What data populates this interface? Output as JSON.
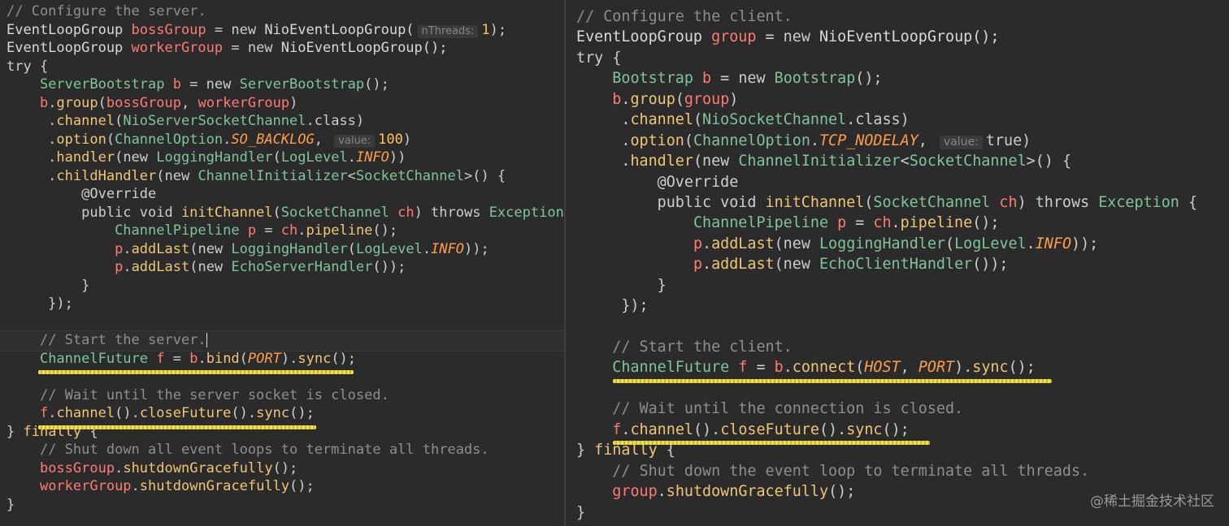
{
  "left_editor": {
    "lines": [
      [
        [
          "comment",
          "// Configure the server."
        ]
      ],
      [
        [
          "type",
          "EventLoopGroup "
        ],
        [
          "var",
          "bossGroup"
        ],
        [
          "default",
          " = new "
        ],
        [
          "type",
          "NioEventLoopGroup("
        ],
        [
          "hint",
          "nThreads:"
        ],
        [
          "number",
          "1"
        ],
        [
          "default",
          ");"
        ]
      ],
      [
        [
          "type",
          "EventLoopGroup "
        ],
        [
          "var",
          "workerGroup"
        ],
        [
          "default",
          " = new "
        ],
        [
          "type",
          "NioEventLoopGroup();"
        ]
      ],
      [
        [
          "default",
          "try {"
        ]
      ],
      [
        [
          "default",
          "    "
        ],
        [
          "cls",
          "ServerBootstrap "
        ],
        [
          "var",
          "b"
        ],
        [
          "default",
          " = new "
        ],
        [
          "cls",
          "ServerBootstrap"
        ],
        [
          "default",
          "();"
        ]
      ],
      [
        [
          "default",
          "    "
        ],
        [
          "var",
          "b"
        ],
        [
          "default",
          "."
        ],
        [
          "method",
          "group"
        ],
        [
          "default",
          "("
        ],
        [
          "var",
          "bossGroup"
        ],
        [
          "default",
          ", "
        ],
        [
          "var",
          "workerGroup"
        ],
        [
          "default",
          ")"
        ]
      ],
      [
        [
          "default",
          "     ."
        ],
        [
          "method",
          "channel"
        ],
        [
          "default",
          "("
        ],
        [
          "cls",
          "NioServerSocketChannel"
        ],
        [
          "default",
          ".class)"
        ]
      ],
      [
        [
          "default",
          "     ."
        ],
        [
          "method",
          "option"
        ],
        [
          "default",
          "("
        ],
        [
          "cls",
          "ChannelOption"
        ],
        [
          "default",
          "."
        ],
        [
          "constant",
          "SO_BACKLOG"
        ],
        [
          "default",
          ", "
        ],
        [
          "hint",
          "value:"
        ],
        [
          "number",
          "100"
        ],
        [
          "default",
          ")"
        ]
      ],
      [
        [
          "default",
          "     ."
        ],
        [
          "method",
          "handler"
        ],
        [
          "default",
          "(new "
        ],
        [
          "cls",
          "LoggingHandler"
        ],
        [
          "default",
          "("
        ],
        [
          "cls",
          "LogLevel"
        ],
        [
          "default",
          "."
        ],
        [
          "constant",
          "INFO"
        ],
        [
          "default",
          "))"
        ]
      ],
      [
        [
          "default",
          "     ."
        ],
        [
          "method",
          "childHandler"
        ],
        [
          "default",
          "(new "
        ],
        [
          "cls",
          "ChannelInitializer"
        ],
        [
          "default",
          "<"
        ],
        [
          "cls",
          "SocketChannel"
        ],
        [
          "default",
          ">() {"
        ]
      ],
      [
        [
          "default",
          "         "
        ],
        [
          "annotation",
          "@Override"
        ]
      ],
      [
        [
          "default",
          "         public void "
        ],
        [
          "method",
          "initChannel"
        ],
        [
          "default",
          "("
        ],
        [
          "cls",
          "SocketChannel "
        ],
        [
          "var",
          "ch"
        ],
        [
          "default",
          ") throws "
        ],
        [
          "cls",
          "Exception"
        ]
      ],
      [
        [
          "default",
          "             "
        ],
        [
          "cls",
          "ChannelPipeline "
        ],
        [
          "var",
          "p"
        ],
        [
          "default",
          " = "
        ],
        [
          "var",
          "ch"
        ],
        [
          "default",
          "."
        ],
        [
          "method",
          "pipeline"
        ],
        [
          "default",
          "();"
        ]
      ],
      [
        [
          "default",
          "             "
        ],
        [
          "var",
          "p"
        ],
        [
          "default",
          "."
        ],
        [
          "method",
          "addLast"
        ],
        [
          "default",
          "(new "
        ],
        [
          "cls",
          "LoggingHandler"
        ],
        [
          "default",
          "("
        ],
        [
          "cls",
          "LogLevel"
        ],
        [
          "default",
          "."
        ],
        [
          "constant",
          "INFO"
        ],
        [
          "default",
          "));"
        ]
      ],
      [
        [
          "default",
          "             "
        ],
        [
          "var",
          "p"
        ],
        [
          "default",
          "."
        ],
        [
          "method",
          "addLast"
        ],
        [
          "default",
          "(new "
        ],
        [
          "cls",
          "EchoServerHandler"
        ],
        [
          "default",
          "());"
        ]
      ],
      [
        [
          "default",
          "         }"
        ]
      ],
      [
        [
          "default",
          "     });"
        ]
      ],
      [
        [
          "default",
          ""
        ]
      ],
      [
        [
          "default",
          "    "
        ],
        [
          "comment",
          "// Start the server."
        ]
      ],
      [
        [
          "default",
          "    "
        ],
        [
          "cls",
          "ChannelFuture "
        ],
        [
          "var",
          "f"
        ],
        [
          "default",
          " = "
        ],
        [
          "var",
          "b"
        ],
        [
          "default",
          "."
        ],
        [
          "method",
          "bind"
        ],
        [
          "default",
          "("
        ],
        [
          "constant",
          "PORT"
        ],
        [
          "default",
          ")."
        ],
        [
          "method",
          "sync"
        ],
        [
          "default",
          "();"
        ]
      ],
      [
        [
          "default",
          ""
        ]
      ],
      [
        [
          "default",
          "    "
        ],
        [
          "comment",
          "// Wait until the server socket is closed."
        ]
      ],
      [
        [
          "default",
          "    "
        ],
        [
          "var",
          "f"
        ],
        [
          "default",
          "."
        ],
        [
          "method",
          "channel"
        ],
        [
          "default",
          "()."
        ],
        [
          "method",
          "closeFuture"
        ],
        [
          "default",
          "()."
        ],
        [
          "method",
          "sync"
        ],
        [
          "default",
          "();"
        ]
      ],
      [
        [
          "default",
          "} "
        ],
        [
          "method",
          "finally"
        ],
        [
          "default",
          " {"
        ]
      ],
      [
        [
          "default",
          "    "
        ],
        [
          "comment",
          "// Shut down all event loops to terminate all threads."
        ]
      ],
      [
        [
          "default",
          "    "
        ],
        [
          "var",
          "bossGroup"
        ],
        [
          "default",
          "."
        ],
        [
          "method",
          "shutdownGracefully"
        ],
        [
          "default",
          "();"
        ]
      ],
      [
        [
          "default",
          "    "
        ],
        [
          "var",
          "workerGroup"
        ],
        [
          "default",
          "."
        ],
        [
          "method",
          "shutdownGracefully"
        ],
        [
          "default",
          "();"
        ]
      ],
      [
        [
          "default",
          "}"
        ]
      ]
    ]
  },
  "right_editor": {
    "lines": [
      [
        [
          "comment",
          "// Configure the client."
        ]
      ],
      [
        [
          "type",
          "EventLoopGroup "
        ],
        [
          "var",
          "group"
        ],
        [
          "default",
          " = new "
        ],
        [
          "type",
          "NioEventLoopGroup();"
        ]
      ],
      [
        [
          "default",
          "try {"
        ]
      ],
      [
        [
          "default",
          "    "
        ],
        [
          "cls",
          "Bootstrap "
        ],
        [
          "var",
          "b"
        ],
        [
          "default",
          " = new "
        ],
        [
          "cls",
          "Bootstrap"
        ],
        [
          "default",
          "();"
        ]
      ],
      [
        [
          "default",
          "    "
        ],
        [
          "var",
          "b"
        ],
        [
          "default",
          "."
        ],
        [
          "method",
          "group"
        ],
        [
          "default",
          "("
        ],
        [
          "var",
          "group"
        ],
        [
          "default",
          ")"
        ]
      ],
      [
        [
          "default",
          "     ."
        ],
        [
          "method",
          "channel"
        ],
        [
          "default",
          "("
        ],
        [
          "cls",
          "NioSocketChannel"
        ],
        [
          "default",
          ".class)"
        ]
      ],
      [
        [
          "default",
          "     ."
        ],
        [
          "method",
          "option"
        ],
        [
          "default",
          "("
        ],
        [
          "cls",
          "ChannelOption"
        ],
        [
          "default",
          "."
        ],
        [
          "constant",
          "TCP_NODELAY"
        ],
        [
          "default",
          ", "
        ],
        [
          "hint",
          "value:"
        ],
        [
          "default",
          "true)"
        ]
      ],
      [
        [
          "default",
          "     ."
        ],
        [
          "method",
          "handler"
        ],
        [
          "default",
          "(new "
        ],
        [
          "cls",
          "ChannelInitializer"
        ],
        [
          "default",
          "<"
        ],
        [
          "cls",
          "SocketChannel"
        ],
        [
          "default",
          ">() {"
        ]
      ],
      [
        [
          "default",
          "         "
        ],
        [
          "annotation",
          "@Override"
        ]
      ],
      [
        [
          "default",
          "         public void "
        ],
        [
          "method",
          "initChannel"
        ],
        [
          "default",
          "("
        ],
        [
          "cls",
          "SocketChannel "
        ],
        [
          "var",
          "ch"
        ],
        [
          "default",
          ") throws "
        ],
        [
          "cls",
          "Exception"
        ],
        [
          "default",
          " {"
        ]
      ],
      [
        [
          "default",
          "             "
        ],
        [
          "cls",
          "ChannelPipeline "
        ],
        [
          "var",
          "p"
        ],
        [
          "default",
          " = "
        ],
        [
          "var",
          "ch"
        ],
        [
          "default",
          "."
        ],
        [
          "method",
          "pipeline"
        ],
        [
          "default",
          "();"
        ]
      ],
      [
        [
          "default",
          "             "
        ],
        [
          "var",
          "p"
        ],
        [
          "default",
          "."
        ],
        [
          "method",
          "addLast"
        ],
        [
          "default",
          "(new "
        ],
        [
          "cls",
          "LoggingHandler"
        ],
        [
          "default",
          "("
        ],
        [
          "cls",
          "LogLevel"
        ],
        [
          "default",
          "."
        ],
        [
          "constant",
          "INFO"
        ],
        [
          "default",
          "));"
        ]
      ],
      [
        [
          "default",
          "             "
        ],
        [
          "var",
          "p"
        ],
        [
          "default",
          "."
        ],
        [
          "method",
          "addLast"
        ],
        [
          "default",
          "(new "
        ],
        [
          "cls",
          "EchoClientHandler"
        ],
        [
          "default",
          "());"
        ]
      ],
      [
        [
          "default",
          "         }"
        ]
      ],
      [
        [
          "default",
          "     });"
        ]
      ],
      [
        [
          "default",
          ""
        ]
      ],
      [
        [
          "default",
          "    "
        ],
        [
          "comment",
          "// Start the client."
        ]
      ],
      [
        [
          "default",
          "    "
        ],
        [
          "cls",
          "ChannelFuture "
        ],
        [
          "var",
          "f"
        ],
        [
          "default",
          " = "
        ],
        [
          "var",
          "b"
        ],
        [
          "default",
          "."
        ],
        [
          "method",
          "connect"
        ],
        [
          "default",
          "("
        ],
        [
          "constant",
          "HOST"
        ],
        [
          "default",
          ", "
        ],
        [
          "constant",
          "PORT"
        ],
        [
          "default",
          ")."
        ],
        [
          "method",
          "sync"
        ],
        [
          "default",
          "();"
        ]
      ],
      [
        [
          "default",
          ""
        ]
      ],
      [
        [
          "default",
          "    "
        ],
        [
          "comment",
          "// Wait until the connection is closed."
        ]
      ],
      [
        [
          "default",
          "    "
        ],
        [
          "var",
          "f"
        ],
        [
          "default",
          "."
        ],
        [
          "method",
          "channel"
        ],
        [
          "default",
          "()."
        ],
        [
          "method",
          "closeFuture"
        ],
        [
          "default",
          "()."
        ],
        [
          "method",
          "sync"
        ],
        [
          "default",
          "();"
        ]
      ],
      [
        [
          "default",
          "} "
        ],
        [
          "method",
          "finally"
        ],
        [
          "default",
          " {"
        ]
      ],
      [
        [
          "default",
          "    "
        ],
        [
          "comment",
          "// Shut down the event loop to terminate all threads."
        ]
      ],
      [
        [
          "default",
          "    "
        ],
        [
          "var",
          "group"
        ],
        [
          "default",
          "."
        ],
        [
          "method",
          "shutdownGracefully"
        ],
        [
          "default",
          "();"
        ]
      ],
      [
        [
          "default",
          "}"
        ]
      ]
    ]
  },
  "watermark": "@稀土掘金技术社区",
  "colors": {
    "background": "#2b2b2b",
    "comment": "#8e8e8e",
    "variable": "#ff7b72",
    "method": "#f0c674",
    "class": "#7ec699",
    "constant": "#ff9d4a",
    "warning_underline": "#f1e04d"
  }
}
